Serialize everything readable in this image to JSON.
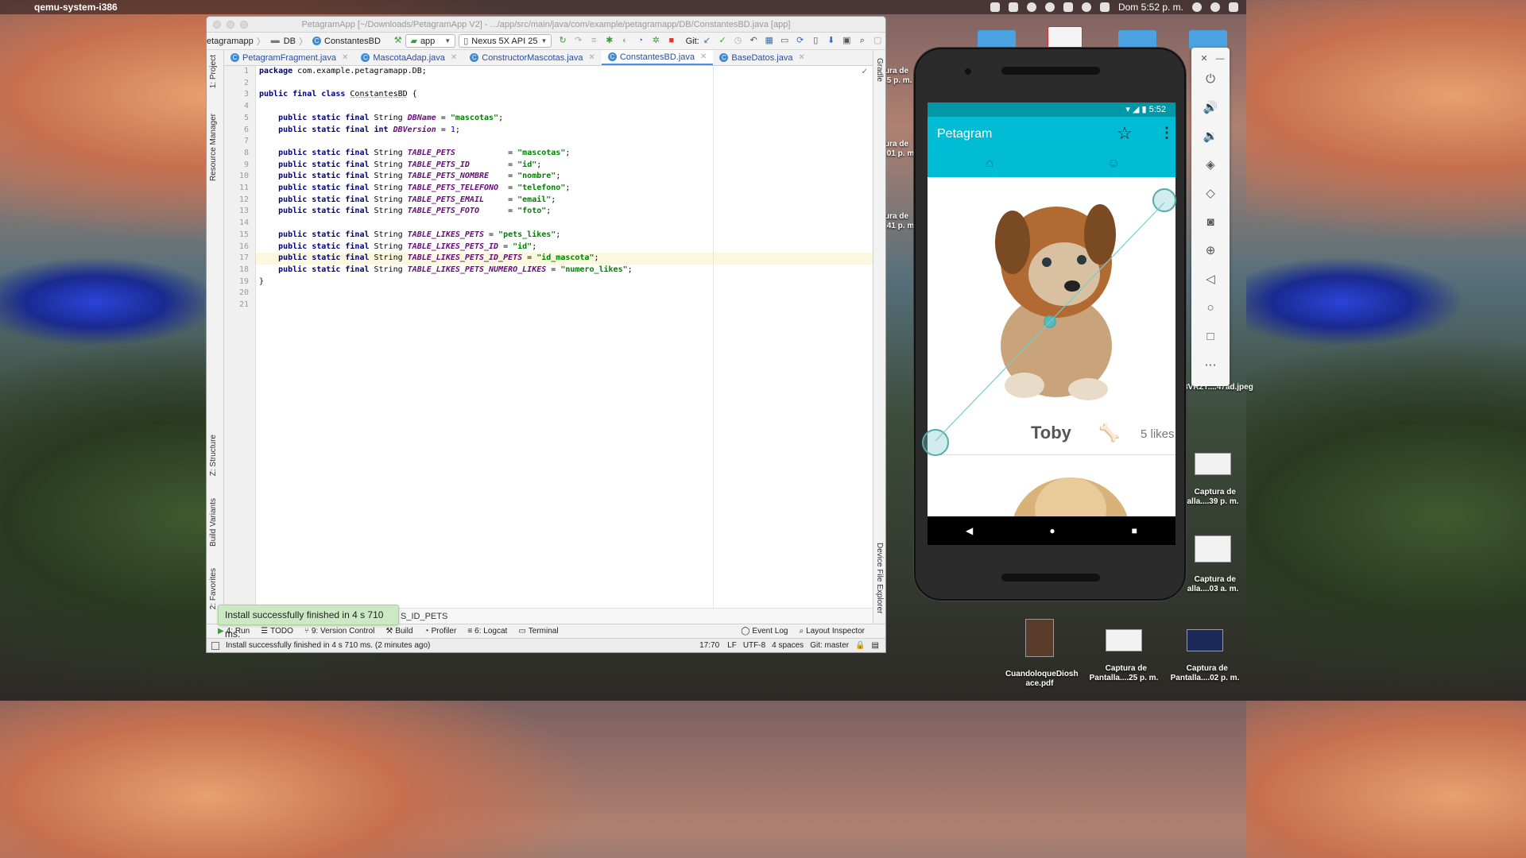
{
  "menubar": {
    "app_name": "qemu-system-i386",
    "clock": "Dom 5:52 p. m."
  },
  "ide": {
    "title": "PetagramApp [~/Downloads/PetagramApp V2] - .../app/src/main/java/com/example/petagramapp/DB/ConstantesBD.java [app]",
    "breadcrumbs": [
      "etagramapp",
      "DB",
      "ConstantesBD"
    ],
    "run_config": "app",
    "device": "Nexus 5X API 25",
    "git_label": "Git:",
    "tabs": [
      {
        "label": "PetagramFragment.java",
        "active": false
      },
      {
        "label": "MascotaAdap.java",
        "active": false
      },
      {
        "label": "ConstructorMascotas.java",
        "active": false
      },
      {
        "label": "ConstantesBD.java",
        "active": true
      },
      {
        "label": "BaseDatos.java",
        "active": false
      }
    ],
    "left_tool_labels": [
      "1: Project",
      "Resource Manager",
      "Z: Structure",
      "Build Variants",
      "2: Favorites"
    ],
    "right_tool_labels": [
      "Gradle",
      "Device File Explorer"
    ],
    "line_numbers": [
      "1",
      "2",
      "3",
      "4",
      "5",
      "6",
      "7",
      "8",
      "9",
      "10",
      "11",
      "12",
      "13",
      "14",
      "15",
      "16",
      "17",
      "18",
      "19",
      "20",
      "21"
    ],
    "highlight_line": 17,
    "code_breadcrumb": "S_ID_PETS",
    "tool_windows": [
      "4: Run",
      "TODO",
      "9: Version Control",
      "Build",
      "Profiler",
      "6: Logcat",
      "Terminal",
      "Event Log",
      "Layout Inspector"
    ],
    "status_message": "Install successfully finished in 4 s 710 ms. (2 minutes ago)",
    "status_right": [
      "17:70",
      "LF",
      "UTF-8",
      "4 spaces",
      "Git: master"
    ],
    "toast": "Install successfully finished in 4 s 710 ms."
  },
  "emulator": {
    "status_time": "5:52",
    "app_title": "Petagram",
    "pet_name": "Toby",
    "likes": "5 likes"
  },
  "desktop": {
    "side_labels": [
      "ura de\n.5 p. m.",
      "ura de\n.01 p. m.",
      "ura de\n.41 p. m."
    ],
    "icons": [
      {
        "label": "Captura de\nalla....39 p. m."
      },
      {
        "label": "Captura de\nalla....03 a. m."
      },
      {
        "label": "CuandoloqueDiosh\nace.pdf"
      },
      {
        "label": "Captura de\nPantalla....25 p. m."
      },
      {
        "label": "Captura de\nPantalla....02 p. m."
      }
    ],
    "jpeg_label": "3VR2Y....47ad.jpeg"
  }
}
